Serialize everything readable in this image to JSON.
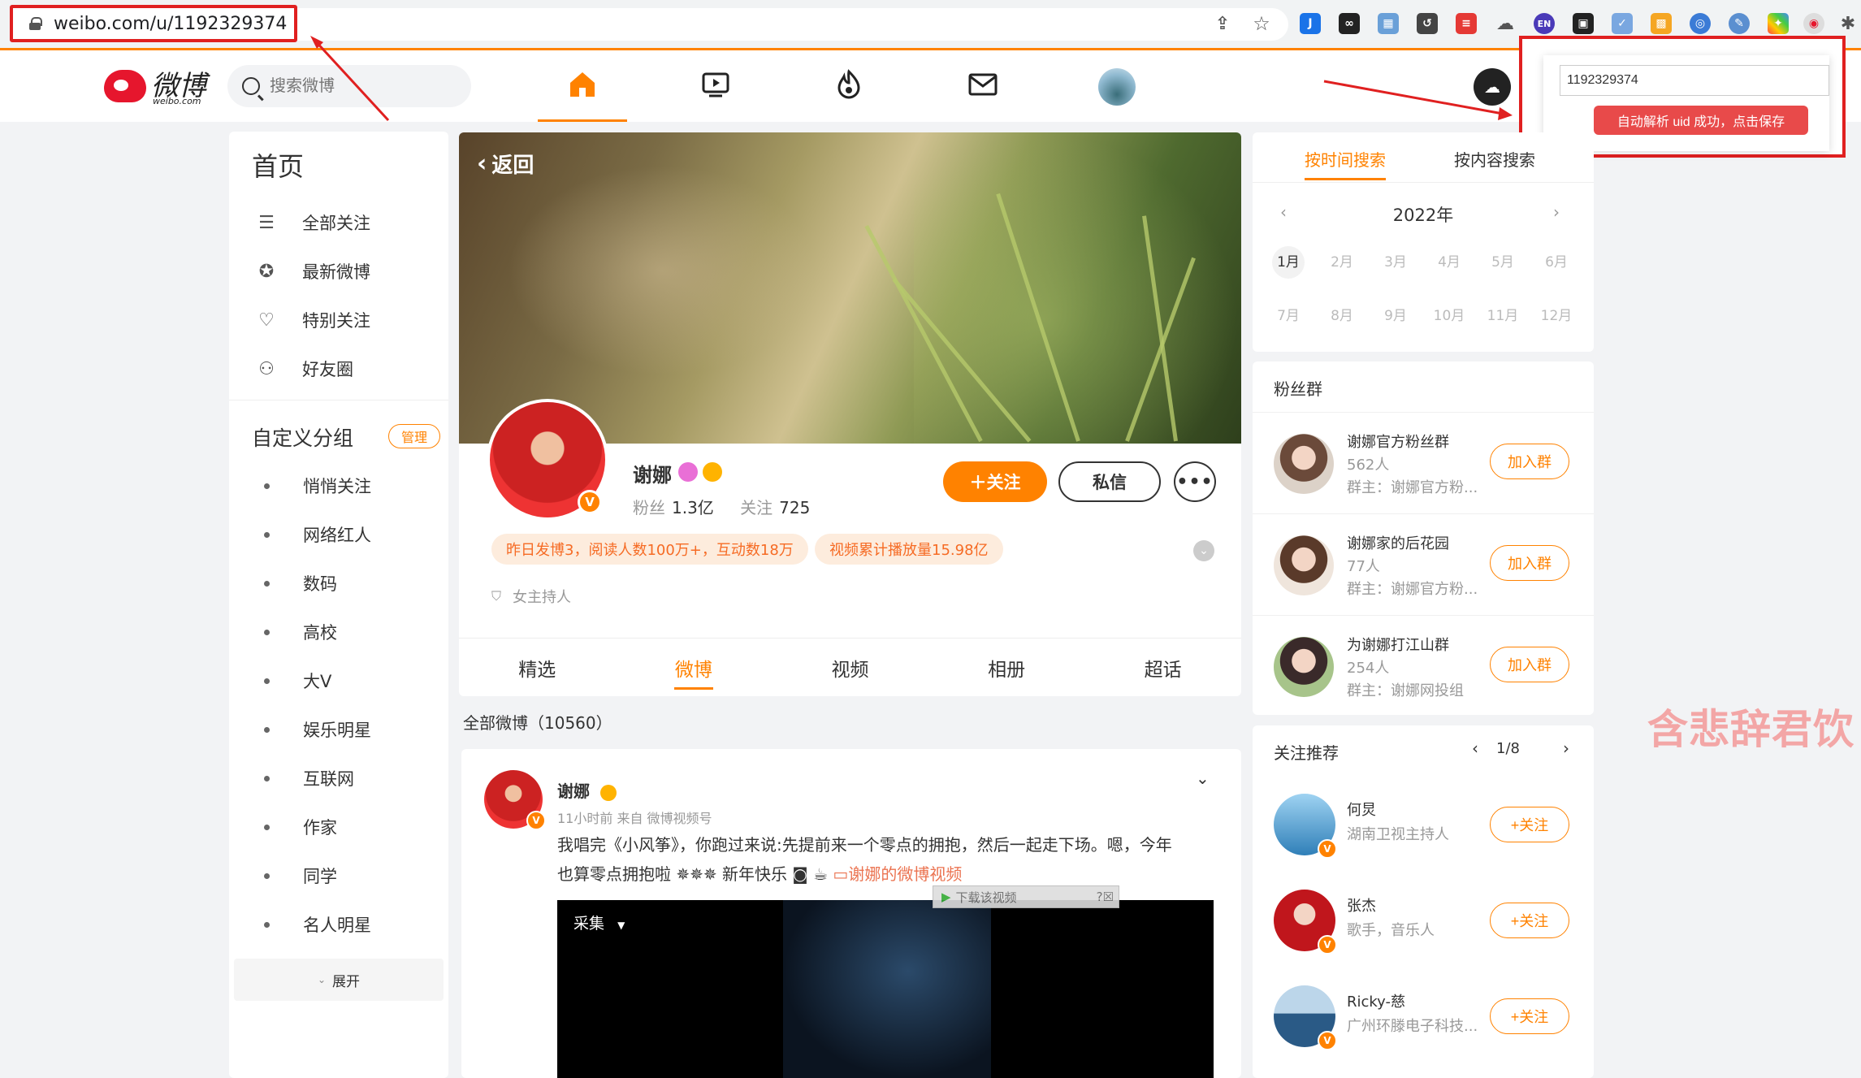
{
  "browser": {
    "url": "weibo.com/u/1192329374",
    "extension_icons": [
      "share-icon",
      "star-icon",
      "j-ext-icon",
      "infinity-ext-icon",
      "grid-ext-icon",
      "refresh-ext-icon",
      "red-list-ext-icon",
      "cloud-ext-icon",
      "en-ext-icon",
      "robot-ext-icon",
      "check-ext-icon",
      "qr-ext-icon",
      "clock-ext-icon",
      "pen-ext-icon",
      "color-ext-icon",
      "weibo-ext-icon",
      "puzzle-icon"
    ]
  },
  "header": {
    "logo_text": "微博",
    "logo_sub": "weibo.com",
    "search_placeholder": "搜索微博",
    "nav": [
      "home-icon",
      "video-icon",
      "hot-icon",
      "message-icon",
      "user-avatar"
    ]
  },
  "popup": {
    "uid_value": "1192329374",
    "parse_button": "自动解析 uid 成功，点击保存"
  },
  "left_sidebar": {
    "title": "首页",
    "items": [
      {
        "label": "全部关注",
        "icon": "list-icon"
      },
      {
        "label": "最新微博",
        "icon": "star-circle-icon"
      },
      {
        "label": "特别关注",
        "icon": "user-heart-icon"
      },
      {
        "label": "好友圈",
        "icon": "users-icon"
      }
    ],
    "groups_title": "自定义分组",
    "manage_label": "管理",
    "groups": [
      "悄悄关注",
      "网络红人",
      "数码",
      "高校",
      "大V",
      "娱乐明星",
      "互联网",
      "作家",
      "同学",
      "名人明星"
    ],
    "expand_label": "展开"
  },
  "profile": {
    "back_label": "返回",
    "name": "谢娜",
    "fans_label": "粉丝",
    "fans_value": "1.3亿",
    "follow_label": "关注",
    "follow_value": "725",
    "follow_button": "关注",
    "message_button": "私信",
    "more_button": "•••",
    "pill1": "昨日发博3，阅读人数100万+，互动数18万",
    "pill2": "视频累计播放量15.98亿",
    "description": "女主持人",
    "tabs": [
      "精选",
      "微博",
      "视频",
      "相册",
      "超话"
    ],
    "active_tab": "微博"
  },
  "feed": {
    "all_label": "全部微博（10560）",
    "post": {
      "name": "谢娜",
      "meta": "11小时前  来自 微博视频号",
      "text_line1": "我唱完《小风筝》，你跑过来说:先提前来一个零点的拥抱，然后一起走下场。嗯，今年",
      "text_line2": "也算零点拥抱啦",
      "text_line2b": "新年快乐",
      "link": "谢娜的微博视频",
      "video_label": "采集",
      "download_bar": "下载该视频"
    }
  },
  "time_search": {
    "tab1": "按时间搜索",
    "tab2": "按内容搜索",
    "year": "2022年",
    "months": [
      "1月",
      "2月",
      "3月",
      "4月",
      "5月",
      "6月",
      "7月",
      "8月",
      "9月",
      "10月",
      "11月",
      "12月"
    ],
    "selected_month": "1月"
  },
  "fan_groups": {
    "title": "粉丝群",
    "items": [
      {
        "name": "谢娜官方粉丝群",
        "count": "562人",
        "owner": "群主：谢娜官方粉...",
        "button": "加入群"
      },
      {
        "name": "谢娜家的后花园",
        "count": "77人",
        "owner": "群主：谢娜官方粉...",
        "button": "加入群"
      },
      {
        "name": "为谢娜打江山群",
        "count": "254人",
        "owner": "群主：谢娜网投组",
        "button": "加入群"
      }
    ]
  },
  "recommend": {
    "title": "关注推荐",
    "page": "1/8",
    "items": [
      {
        "name": "何炅",
        "desc": "湖南卫视主持人",
        "button": "+关注"
      },
      {
        "name": "张杰",
        "desc": "歌手，音乐人",
        "button": "+关注"
      },
      {
        "name": "Ricky-慈",
        "desc": "广州环滕电子科技...",
        "button": "+关注"
      }
    ]
  },
  "watermark": "含悲辞君饮",
  "colors": {
    "accent": "#ff8200",
    "annotation": "#e02020",
    "weibo_red": "#e6162d"
  }
}
